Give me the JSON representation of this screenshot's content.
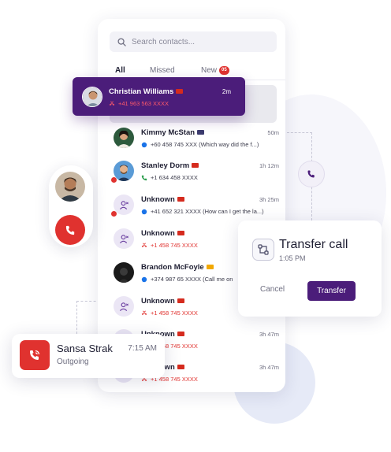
{
  "search": {
    "placeholder": "Search contacts..."
  },
  "tabs": [
    {
      "label": "All"
    },
    {
      "label": "Missed"
    },
    {
      "label": "New",
      "badge": "05"
    }
  ],
  "highlighted": {
    "name": "Christian Williams",
    "flag": "ch",
    "time": "2m",
    "detail": "+41 963 563 XXXX",
    "kind": "missed"
  },
  "calls": [
    {
      "name": "Kimmy McStan",
      "flag": "us",
      "time": "50m",
      "detail": "+60 458 745 XXX (Which way did the f...)",
      "kind": "message"
    },
    {
      "name": "Stanley Dorm",
      "flag": "ca",
      "time": "1h 12m",
      "detail": "+1 634 458 XXXX",
      "kind": "incoming"
    },
    {
      "name": "Unknown",
      "flag": "ch",
      "time": "3h 25m",
      "detail": "+41 652 321 XXXX (How can I get the la...)",
      "kind": "message"
    },
    {
      "name": "Unknown",
      "flag": "ca",
      "time": "",
      "detail": "+1 458 745 XXXX",
      "kind": "missed"
    },
    {
      "name": "Brandon McFoyle",
      "flag": "am",
      "time": "",
      "detail": "+374 987 65 XXXX (Call me on",
      "kind": "message"
    },
    {
      "name": "Unknown",
      "flag": "ca",
      "time": "",
      "detail": "+1 458 745 XXXX",
      "kind": "missed"
    },
    {
      "name": "Unknown",
      "flag": "ca",
      "time": "3h 47m",
      "detail": "+1 458 745 XXXX",
      "kind": "missed"
    },
    {
      "name": "Unknown",
      "flag": "ca",
      "time": "3h 47m",
      "detail": "+1 458 745 XXXX",
      "kind": "missed"
    }
  ],
  "transfer": {
    "title": "Transfer call",
    "time": "1:05 PM",
    "cancel_label": "Cancel",
    "transfer_label": "Transfer"
  },
  "outgoing": {
    "name": "Sansa Strak",
    "status": "Outgoing",
    "time": "7:15 AM"
  },
  "colors": {
    "accent": "#4b1d7a",
    "missed": "#e0322f",
    "message": "#1a73e8",
    "incoming": "#2e9e4f"
  }
}
